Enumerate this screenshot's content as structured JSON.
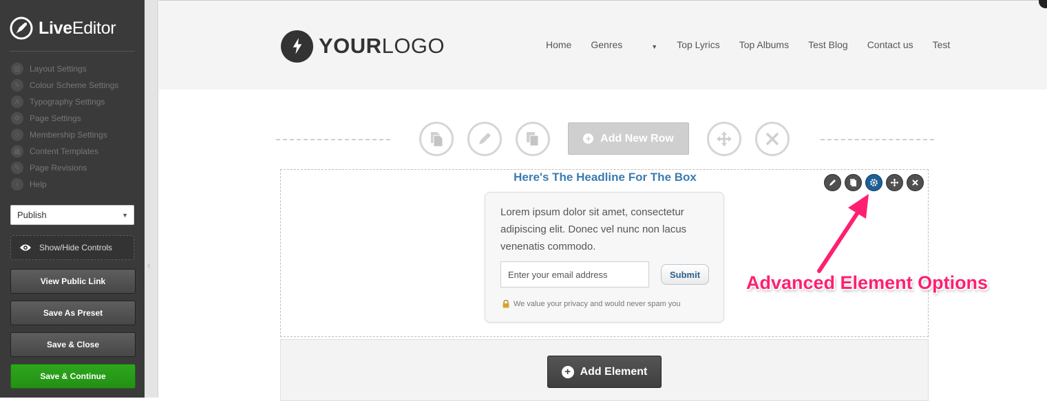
{
  "sidebar": {
    "brand_bold": "Live",
    "brand_light": "Editor",
    "menu": [
      {
        "label": "Layout Settings",
        "icon": "layout-icon"
      },
      {
        "label": "Colour Scheme Settings",
        "icon": "brush-icon"
      },
      {
        "label": "Typography Settings",
        "icon": "typography-icon"
      },
      {
        "label": "Page Settings",
        "icon": "gear-icon"
      },
      {
        "label": "Membership Settings",
        "icon": "users-icon"
      },
      {
        "label": "Content Templates",
        "icon": "grid-icon"
      },
      {
        "label": "Page Revisions",
        "icon": "pencil-icon"
      },
      {
        "label": "Help",
        "icon": "info-icon"
      }
    ],
    "status_select": "Publish",
    "toggle_controls": "Show/Hide Controls",
    "buttons": {
      "view_public": "View Public Link",
      "save_preset": "Save As Preset",
      "save_close": "Save & Close",
      "save_continue": "Save & Continue"
    },
    "colors": {
      "save_continue": "#2a9a1a",
      "sidebar_bg": "#3a3a3a"
    }
  },
  "site": {
    "logo_bold": "YOUR",
    "logo_light": "LOGO",
    "nav": [
      "Home",
      "Genres",
      "Top Lyrics",
      "Top Albums",
      "Test Blog",
      "Contact us",
      "Test"
    ]
  },
  "row_controls": {
    "add_row_label": "Add New Row"
  },
  "element": {
    "headline": "Here's The Headline For The Box",
    "body": "Lorem ipsum dolor sit amet, consectetur adipiscing elit. Donec vel nunc non lacus venenatis commodo.",
    "email_placeholder": "Enter your email address",
    "submit_label": "Submit",
    "privacy_note": "We value your privacy and would never spam you"
  },
  "annotation": {
    "text": "Advanced Element Options",
    "color": "#ff1f70"
  },
  "add_element_label": "Add Element"
}
